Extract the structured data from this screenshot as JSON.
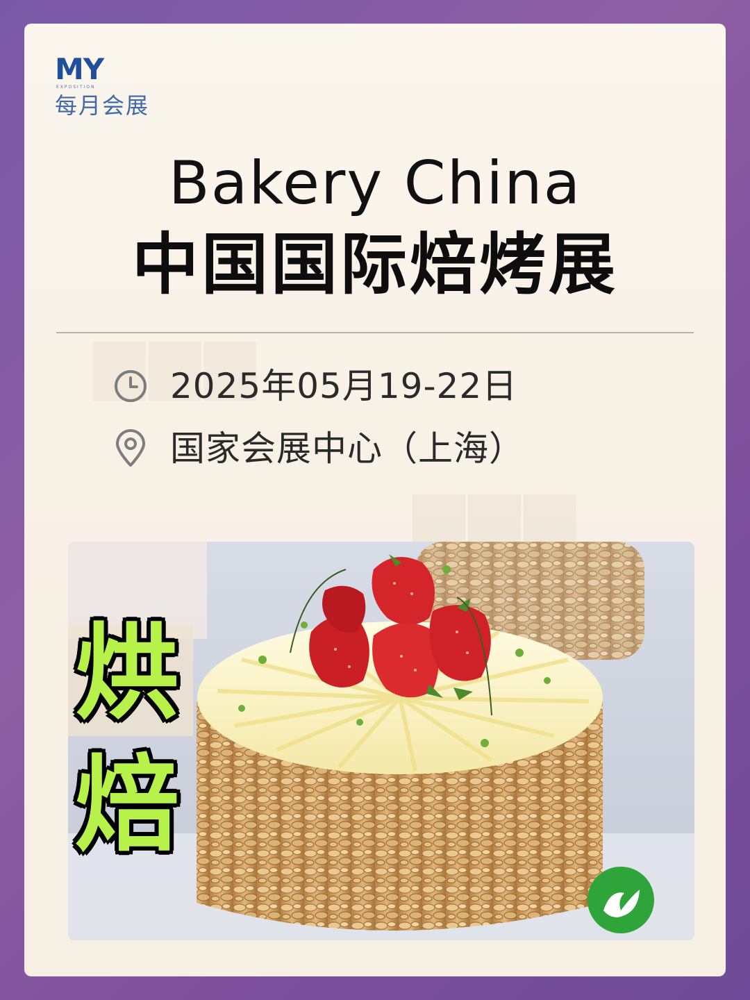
{
  "logo": {
    "mark": "MY",
    "sub": "EXPOSITION",
    "cn": "每月会展"
  },
  "title": {
    "en": "Bakery China",
    "cn": "中国国际焙烤展"
  },
  "info": {
    "date": "2025年05月19-22日",
    "venue": "国家会展中心（上海）",
    "date_icon": "clock-icon",
    "venue_icon": "location-pin-icon"
  },
  "photo": {
    "overlay_line1": "烘",
    "overlay_line2": "焙",
    "brand_icon": "leaf-logo-icon"
  },
  "colors": {
    "background": "#7a5aa8",
    "card": "#fbf6ee",
    "logo_blue": "#1f4f9a",
    "overlay_green": "#b7f24b",
    "brand_green": "#2ea43a"
  }
}
